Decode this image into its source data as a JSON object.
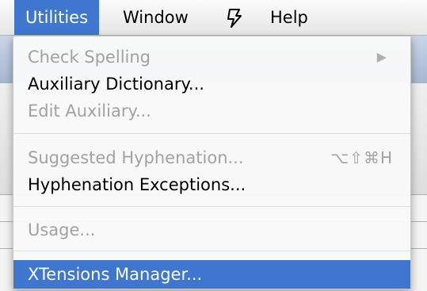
{
  "menubar": {
    "items": [
      {
        "label": "Utilities",
        "active": true
      },
      {
        "label": "Window",
        "active": false
      },
      {
        "label": "",
        "icon": "script-icon"
      },
      {
        "label": "Help",
        "active": false
      }
    ]
  },
  "menu": {
    "items": [
      {
        "label": "Check Spelling",
        "enabled": false,
        "submenu": true
      },
      {
        "label": "Auxiliary Dictionary...",
        "enabled": true
      },
      {
        "label": "Edit Auxiliary...",
        "enabled": false
      },
      {
        "label": "Suggested Hyphenation...",
        "enabled": false,
        "shortcut": "⌥⇧⌘H"
      },
      {
        "label": "Hyphenation Exceptions...",
        "enabled": true
      },
      {
        "label": "Usage...",
        "enabled": false
      },
      {
        "label": "XTensions Manager...",
        "enabled": true,
        "highlighted": true
      }
    ]
  },
  "colors": {
    "accent": "#3f76cf",
    "disabled_text": "#a2a2a2"
  }
}
